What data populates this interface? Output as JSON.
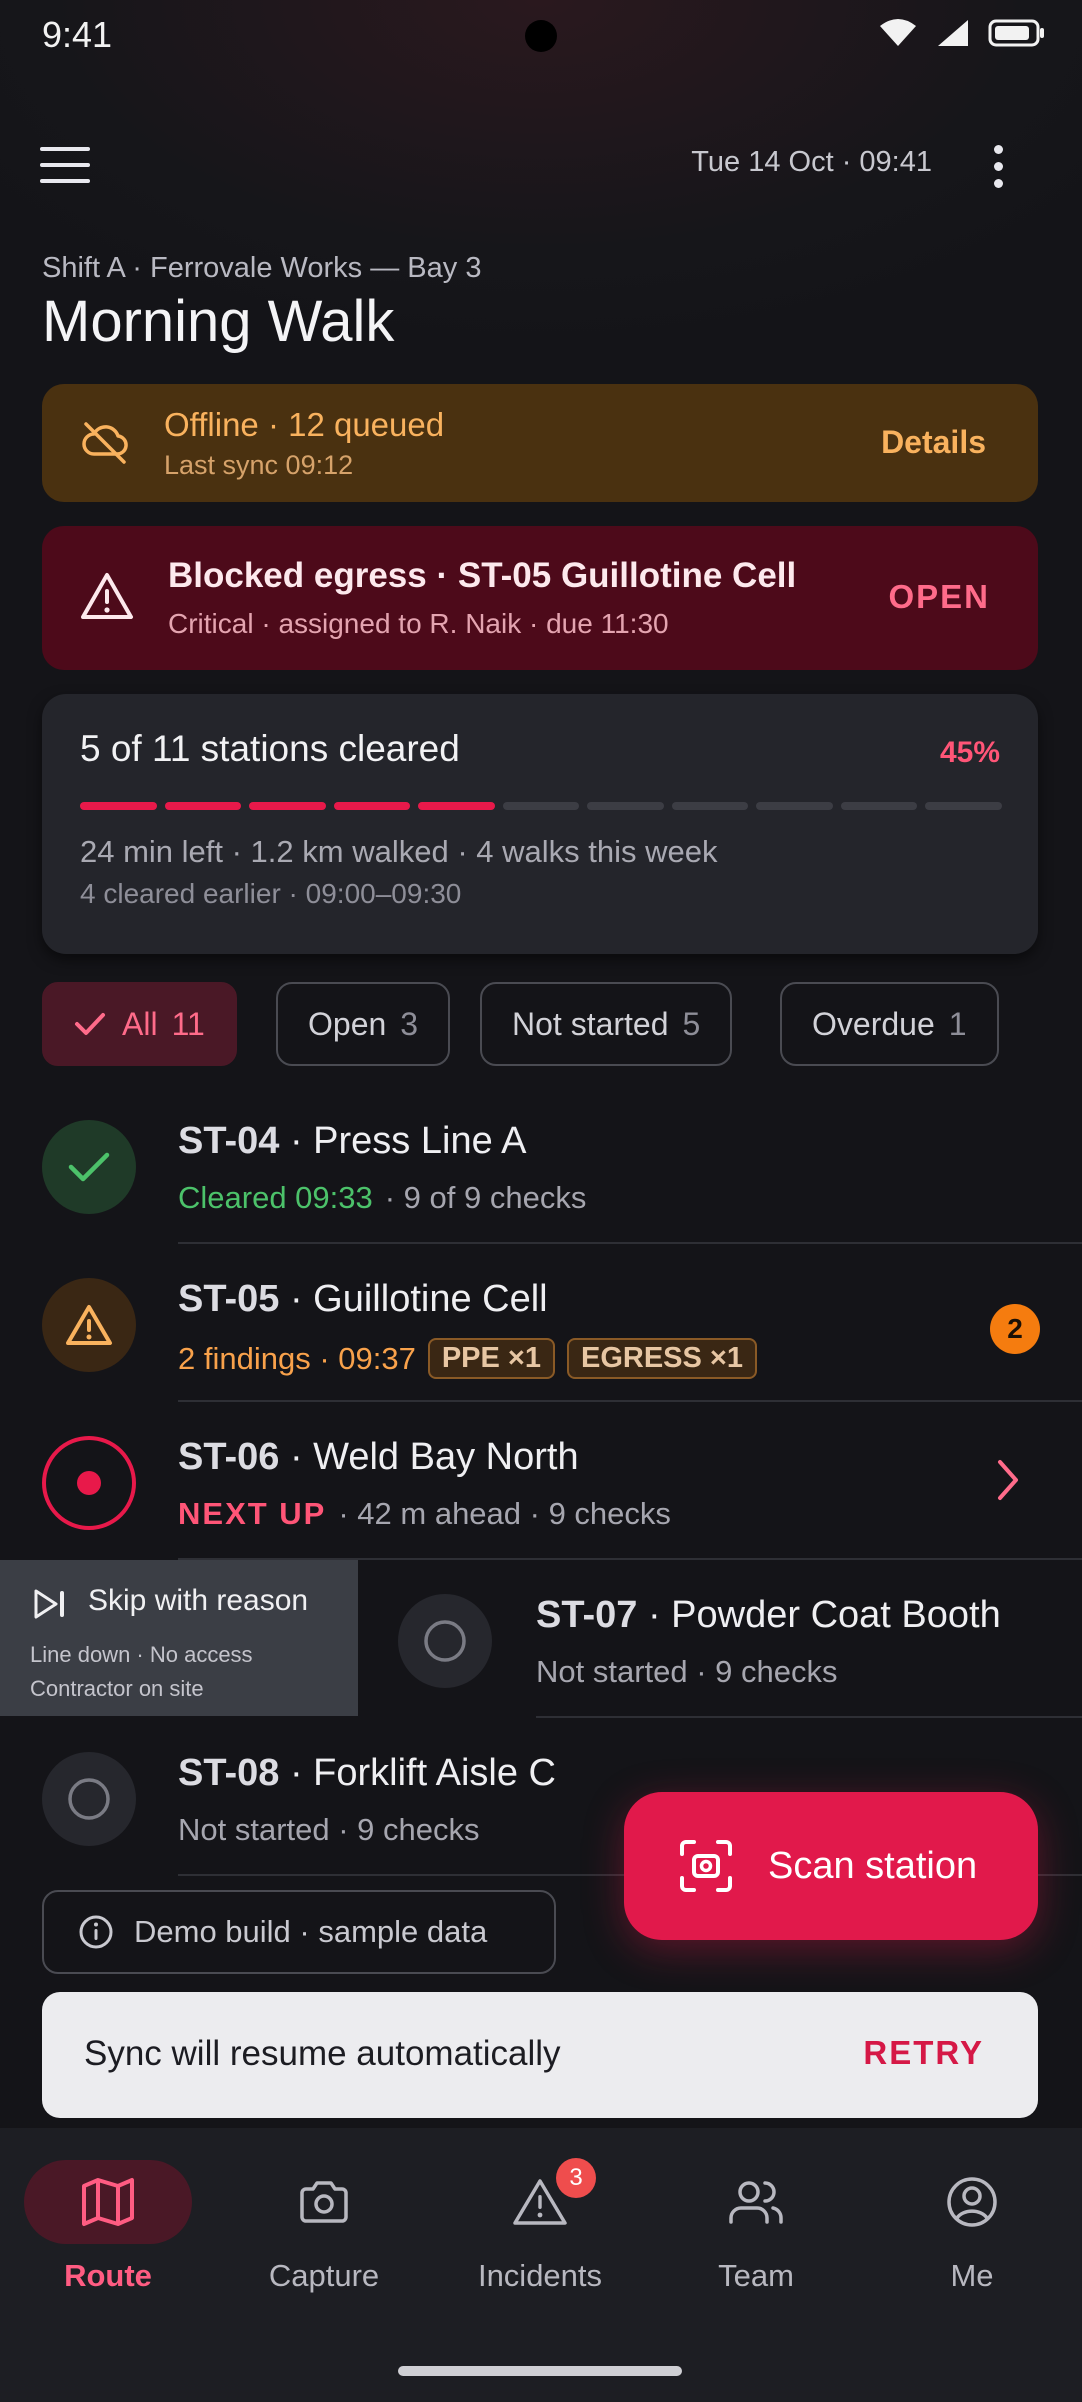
{
  "status_bar": {
    "time": "9:41"
  },
  "top_bar": {
    "datetime": "Tue 14 Oct · 09:41"
  },
  "header": {
    "subtitle": "Shift A · Ferrovale Works — Bay 3",
    "title": "Morning Walk"
  },
  "offline_banner": {
    "title": "Offline · 12 queued",
    "subtitle": "Last sync 09:12",
    "action": "Details"
  },
  "alert": {
    "title": "Blocked egress · ST-05 Guillotine Cell",
    "subtitle": "Critical · assigned to R. Naik · due 11:30",
    "action": "OPEN"
  },
  "progress": {
    "title": "5 of 11 stations cleared",
    "percent_label": "45%",
    "cleared": 5,
    "total": 11,
    "stats": "24 min left · 1.2 km walked · 4 walks this week",
    "earlier": "4 cleared earlier · 09:00–09:30"
  },
  "filters": [
    {
      "label": "All",
      "count": "11",
      "selected": true
    },
    {
      "label": "Open",
      "count": "3",
      "selected": false
    },
    {
      "label": "Not started",
      "count": "5",
      "selected": false
    },
    {
      "label": "Overdue",
      "count": "1",
      "selected": false
    }
  ],
  "stations": [
    {
      "code": "ST-04",
      "name": "Press Line A",
      "status": "Cleared 09:33",
      "detail": "· 9 of 9 checks"
    },
    {
      "code": "ST-05",
      "name": "Guillotine Cell",
      "status": "2 findings · 09:37",
      "tags": [
        "PPE ×1",
        "EGRESS ×1"
      ],
      "badge": "2"
    },
    {
      "code": "ST-06",
      "name": "Weld Bay North",
      "status": "NEXT UP",
      "detail": "· 42 m ahead · 9 checks"
    },
    {
      "code": "ST-07",
      "name": "Powder Coat Booth",
      "status": "Not started · 9 checks"
    },
    {
      "code": "ST-08",
      "name": "Forklift Aisle C",
      "status": "Not started · 9 checks"
    }
  ],
  "swipe_action": {
    "title": "Skip with reason",
    "reasons_line1": "Line down · No access",
    "reasons_line2": "Contractor on site"
  },
  "fab": {
    "label": "Scan station"
  },
  "demo_chip": {
    "label": "Demo build · sample data"
  },
  "snackbar": {
    "message": "Sync will resume automatically",
    "action": "RETRY"
  },
  "bottom_nav": [
    {
      "label": "Route",
      "icon": "map-icon",
      "active": true
    },
    {
      "label": "Capture",
      "icon": "camera-icon",
      "active": false
    },
    {
      "label": "Incidents",
      "icon": "warning-icon",
      "active": false,
      "badge": "3"
    },
    {
      "label": "Team",
      "icon": "team-icon",
      "active": false
    },
    {
      "label": "Me",
      "icon": "account-icon",
      "active": false
    }
  ],
  "colors": {
    "accent": "#E1194B",
    "warning": "#F9B25E",
    "success": "#4CC26A",
    "critical_bg": "#4D0A1A"
  }
}
